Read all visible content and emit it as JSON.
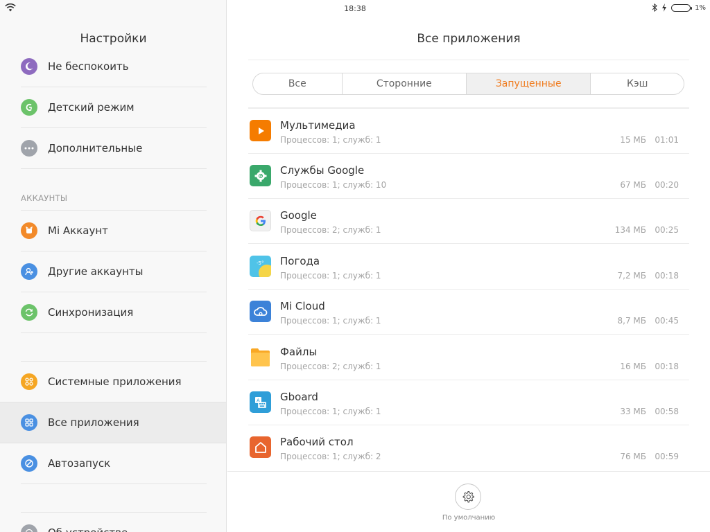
{
  "status_bar": {
    "time": "18:38",
    "battery": "1%"
  },
  "sidebar": {
    "title": "Настройки",
    "items_top": [
      {
        "label": "Не беспокоить",
        "icon": "moon-icon",
        "color": "#8e6bbf"
      },
      {
        "label": "Детский режим",
        "icon": "child-mode-icon",
        "color": "#6cc36a"
      },
      {
        "label": "Дополнительные",
        "icon": "more-dots-icon",
        "color": "#a0a4ab"
      }
    ],
    "section_accounts": "АККАУНТЫ",
    "items_accounts": [
      {
        "label": "Mi Аккаунт",
        "icon": "mi-account-icon",
        "color": "#f28a2a"
      },
      {
        "label": "Другие аккаунты",
        "icon": "add-user-icon",
        "color": "#4a90e2"
      },
      {
        "label": "Синхронизация",
        "icon": "sync-icon",
        "color": "#6cc36a"
      }
    ],
    "items_apps": [
      {
        "label": "Системные приложения",
        "icon": "system-apps-icon",
        "color": "#f5a623"
      },
      {
        "label": "Все приложения",
        "icon": "all-apps-icon",
        "color": "#4a90e2",
        "active": true
      },
      {
        "label": "Автозапуск",
        "icon": "autostart-icon",
        "color": "#4a90e2"
      }
    ],
    "item_about": {
      "label": "Об устройстве",
      "icon": "device-info-icon",
      "color": "#a0a4ab"
    }
  },
  "main": {
    "title": "Все приложения",
    "tabs": [
      {
        "label": "Все"
      },
      {
        "label": "Сторонние"
      },
      {
        "label": "Запущенные",
        "active": true
      },
      {
        "label": "Кэш"
      }
    ],
    "apps": [
      {
        "name": "Мультимедиа",
        "details": "Процессов: 1; служб: 1",
        "size": "15 МБ",
        "time": "01:01",
        "icon": "multimedia-play-icon",
        "color": "#f57c00"
      },
      {
        "name": "Службы Google",
        "details": "Процессов: 1; служб: 10",
        "size": "67 МБ",
        "time": "00:20",
        "icon": "google-services-gear-icon",
        "color": "#3aa86b"
      },
      {
        "name": "Google",
        "details": "Процессов: 2; служб: 1",
        "size": "134 МБ",
        "time": "00:25",
        "icon": "google-g-icon",
        "color": "#eeeeee"
      },
      {
        "name": "Погода",
        "details": "Процессов: 1; служб: 1",
        "size": "7,2 МБ",
        "time": "00:18",
        "icon": "weather-icon",
        "color": "#4fc3e8"
      },
      {
        "name": "Mi Cloud",
        "details": "Процессов: 1; служб: 1",
        "size": "8,7 МБ",
        "time": "00:45",
        "icon": "cloud-icon",
        "color": "#3c82d8"
      },
      {
        "name": "Файлы",
        "details": "Процессов: 2; служб: 1",
        "size": "16 МБ",
        "time": "00:18",
        "icon": "folder-icon",
        "color": "#ffb74d"
      },
      {
        "name": "Gboard",
        "details": "Процессов: 1; служб: 1",
        "size": "33 МБ",
        "time": "00:58",
        "icon": "keyboard-icon",
        "color": "#2f9ed8"
      },
      {
        "name": "Рабочий стол",
        "details": "Процессов: 1; служб: 2",
        "size": "76 МБ",
        "time": "00:59",
        "icon": "home-icon",
        "color": "#e8652e"
      }
    ],
    "default_label": "По умолчанию",
    "default_icon": "settings-gear-icon"
  }
}
